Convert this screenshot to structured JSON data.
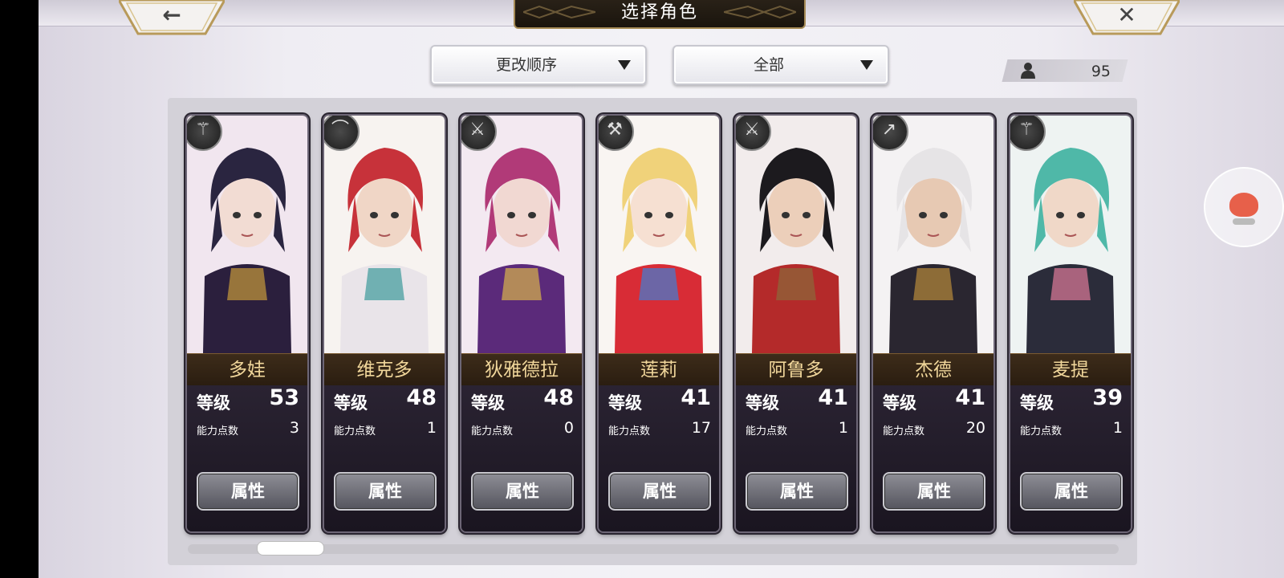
{
  "header": {
    "title": "选择角色",
    "back_glyph": "←",
    "close_glyph": "✕"
  },
  "filters": {
    "sort_label": "更改顺序",
    "category_label": "全部"
  },
  "roster_count": "95",
  "characters": [
    {
      "name": "多娃",
      "weapon_icon": "staff-icon",
      "weapon_glyph": "⚚",
      "level_label": "等级",
      "level": "53",
      "ap_label": "能力点数",
      "ap": "3",
      "button": "属性",
      "palette": {
        "bg": "#f1e6ef",
        "hair": "#2a2540",
        "skin": "#f2dcd3",
        "cloth": "#2b1f3d",
        "accent": "#c79a3a"
      }
    },
    {
      "name": "维克多",
      "weapon_icon": "bow-icon",
      "weapon_glyph": "⌒",
      "level_label": "等级",
      "level": "48",
      "ap_label": "能力点数",
      "ap": "1",
      "button": "属性",
      "palette": {
        "bg": "#f7f3f0",
        "hair": "#c7323a",
        "skin": "#f0d6c6",
        "cloth": "#e9e4e9",
        "accent": "#3c9a9a"
      }
    },
    {
      "name": "狄雅德拉",
      "weapon_icon": "sword-icon",
      "weapon_glyph": "⚔",
      "level_label": "等级",
      "level": "48",
      "ap_label": "能力点数",
      "ap": "0",
      "button": "属性",
      "palette": {
        "bg": "#f3e9f1",
        "hair": "#b13a78",
        "skin": "#f1d8d2",
        "cloth": "#5b2a7a",
        "accent": "#d8b44c"
      }
    },
    {
      "name": "莲莉",
      "weapon_icon": "axe-icon",
      "weapon_glyph": "⚒",
      "level_label": "等级",
      "level": "41",
      "ap_label": "能力点数",
      "ap": "17",
      "button": "属性",
      "palette": {
        "bg": "#f9f5f2",
        "hair": "#f0d27a",
        "skin": "#f6e0d2",
        "cloth": "#d82c36",
        "accent": "#3f7fd6"
      }
    },
    {
      "name": "阿鲁多",
      "weapon_icon": "sword-icon",
      "weapon_glyph": "⚔",
      "level_label": "等级",
      "level": "41",
      "ap_label": "能力点数",
      "ap": "1",
      "button": "属性",
      "palette": {
        "bg": "#f2ecec",
        "hair": "#1c1a1e",
        "skin": "#eccfba",
        "cloth": "#b42a2a",
        "accent": "#8a6a3a"
      }
    },
    {
      "name": "杰德",
      "weapon_icon": "spear-icon",
      "weapon_glyph": "↗",
      "level_label": "等级",
      "level": "41",
      "ap_label": "能力点数",
      "ap": "20",
      "button": "属性",
      "palette": {
        "bg": "#f4f2f3",
        "hair": "#e6e4e6",
        "skin": "#e7c9b3",
        "cloth": "#2a2630",
        "accent": "#b88a3a"
      }
    },
    {
      "name": "麦提",
      "weapon_icon": "staff-icon",
      "weapon_glyph": "⚚",
      "level_label": "等级",
      "level": "39",
      "ap_label": "能力点数",
      "ap": "1",
      "button": "属性",
      "palette": {
        "bg": "#eef3f2",
        "hair": "#4fb8a8",
        "skin": "#f0d8c8",
        "cloth": "#2b2c3a",
        "accent": "#e07a9a"
      }
    }
  ]
}
